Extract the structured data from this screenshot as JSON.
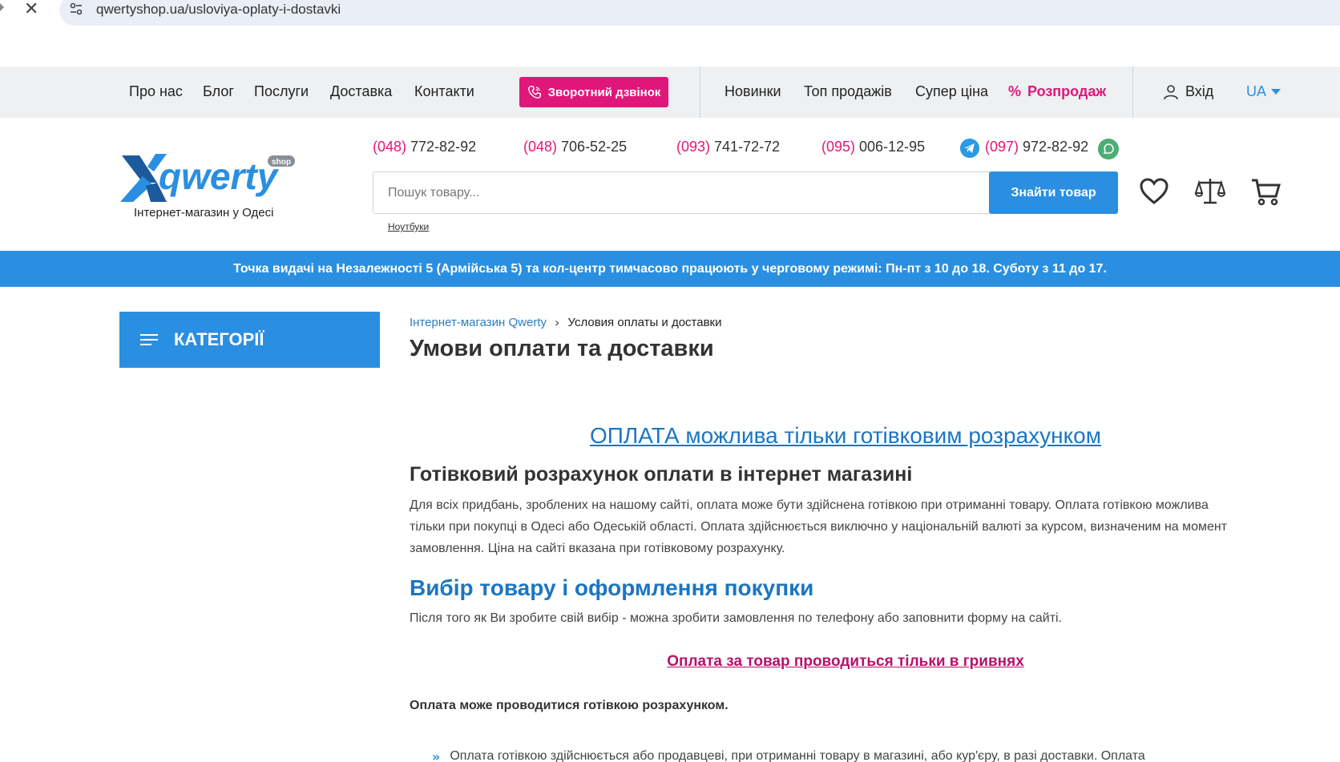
{
  "browser": {
    "url": "qwertyshop.ua/usloviya-oplaty-i-dostavki"
  },
  "topnav": {
    "links": [
      "Про нас",
      "Блог",
      "Послуги",
      "Доставка",
      "Контакти"
    ],
    "callback_label": "Зворотний дзвінок",
    "secondary_links": [
      "Новинки",
      "Топ продажів",
      "Супер ціна"
    ],
    "sale_label": "Розпродаж",
    "login_label": "Вхід",
    "language": "UA"
  },
  "header": {
    "logo_text": "qwerty",
    "logo_badge": "shop",
    "tagline": "Інтернет-магазин у Одесі",
    "phones": [
      {
        "code": "(048)",
        "number": " 772-82-92"
      },
      {
        "code": "(048)",
        "number": " 706-52-25"
      },
      {
        "code": "(093)",
        "number": " 741-72-72"
      },
      {
        "code": "(095)",
        "number": " 006-12-95"
      },
      {
        "code": "(097)",
        "number": " 972-82-92"
      }
    ],
    "search_placeholder": "Пошук товару...",
    "search_button": "Знайти товар",
    "search_hint": "Ноутбуки"
  },
  "banner": {
    "text": "Точка видачі на Незалежності 5 (Армійська 5) та кол-центр тимчасово працюють у черговому режимі: Пн-пт з 10 до 18. Суботу з 11 до 17."
  },
  "sidebar": {
    "categories_label": "КАТЕГОРІЇ"
  },
  "breadcrumb": {
    "home": "Інтернет-магазин Qwerty",
    "current": "Условия оплаты и доставки"
  },
  "content": {
    "title": "Умови оплати та доставки",
    "payment_heading": "ОПЛАТА можлива тільки готівковим розрахунком",
    "cash_heading": "Готівковий розрахунок оплати в інтернет магазині",
    "cash_paragraph_lines": [
      "Для всіх придбань, зроблених на нашому сайті, оплата може бути здійснена готівкою при отриманні товару. Оплата готівкою можлива",
      "тільки при покупці в Одесі або Одеській області. Оплата здійснюється виключно у національній валюті за курсом, визначеним на момент",
      "замовлення. Ціна на сайті вказана при готівковому розрахунку."
    ],
    "choice_heading": "Вибір товару і оформлення покупки",
    "choice_paragraph": "Після того як Ви зробите свій вибір - можна зробити замовлення по телефону або заповнити форму на сайті.",
    "uah_link": "Оплата за товар проводиться тільки в гривнях",
    "cash_note": "Оплата може проводитися готівкою розрахунком.",
    "bullet_text": "Оплата готівкою здійснюється або продавцеві, при отриманні товару в магазині, або кур'єру, в разі доставки. Оплата"
  }
}
